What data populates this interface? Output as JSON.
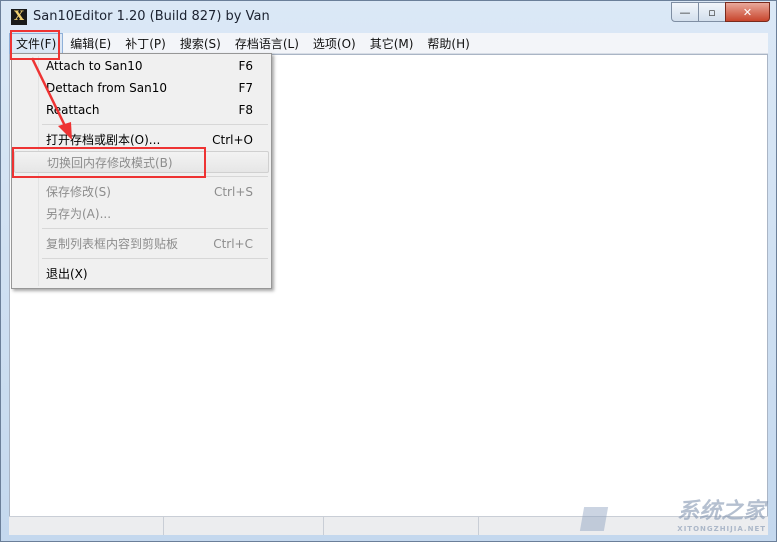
{
  "window": {
    "title": "San10Editor 1.20 (Build 827) by Van",
    "app_icon": "X",
    "controls": {
      "minimize": "—",
      "restore": "▫",
      "close": "✕"
    }
  },
  "menubar": {
    "items": [
      {
        "label": "文件(F)"
      },
      {
        "label": "编辑(E)"
      },
      {
        "label": "补丁(P)"
      },
      {
        "label": "搜索(S)"
      },
      {
        "label": "存档语言(L)"
      },
      {
        "label": "选项(O)"
      },
      {
        "label": "其它(M)"
      },
      {
        "label": "帮助(H)"
      }
    ]
  },
  "file_menu": {
    "items": [
      {
        "label": "Attach to San10",
        "shortcut": "F6",
        "enabled": true
      },
      {
        "label": "Dettach from San10",
        "shortcut": "F7",
        "enabled": true
      },
      {
        "label": "Reattach",
        "shortcut": "F8",
        "enabled": true
      },
      {
        "label": "打开存档或剧本(O)...",
        "shortcut": "Ctrl+O",
        "enabled": true
      },
      {
        "label": "切换回内存修改模式(B)",
        "shortcut": "",
        "enabled": false
      },
      {
        "label": "保存修改(S)",
        "shortcut": "Ctrl+S",
        "enabled": false
      },
      {
        "label": "另存为(A)...",
        "shortcut": "",
        "enabled": false
      },
      {
        "label": "复制列表框内容到剪贴板",
        "shortcut": "Ctrl+C",
        "enabled": false
      },
      {
        "label": "退出(X)",
        "shortcut": "",
        "enabled": true
      }
    ]
  },
  "watermark": {
    "text": "系统之家",
    "subtext": "XITONGZHIJIA.NET"
  },
  "colors": {
    "annotation": "#ee3333",
    "menu_highlight": "#dbe7f5"
  }
}
